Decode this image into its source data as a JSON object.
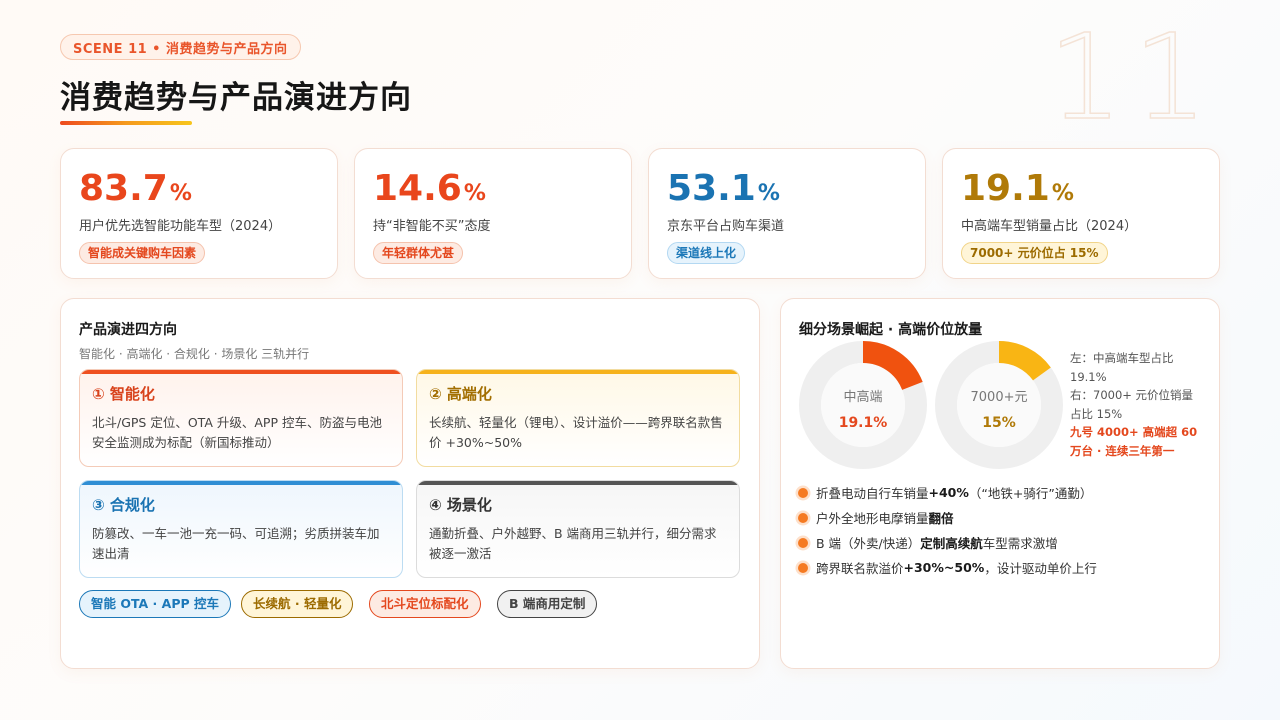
{
  "header": {
    "scene_tag": "SCENE 11 • 消费趋势与产品方向",
    "title": "消费趋势与产品演进方向",
    "watermark_number": "11"
  },
  "stats": [
    {
      "value": "83.7",
      "unit": "%",
      "label": "用户优先选智能功能车型（2024）",
      "badge": "智能成关键购车因素",
      "color": "#e9461c"
    },
    {
      "value": "14.6",
      "unit": "%",
      "label": "持“非智能不买”态度",
      "badge": "年轻群体尤甚",
      "color": "#e9461c"
    },
    {
      "value": "53.1",
      "unit": "%",
      "label": "京东平台占购车渠道",
      "badge": "渠道线上化",
      "color": "#1a73b2"
    },
    {
      "value": "19.1",
      "unit": "%",
      "label": "中高端车型销量占比（2024）",
      "badge": "7000+ 元价位占 15%",
      "color": "#b07a08"
    }
  ],
  "directions": {
    "title": "产品演进四方向",
    "subtitle": "智能化 · 高端化 · 合规化 · 场景化 三轨并行",
    "items": [
      {
        "title": "① 智能化",
        "text": "北斗/GPS 定位、OTA 升级、APP 控车、防盗与电池安全监测成为标配（新国标推动）"
      },
      {
        "title": "② 高端化",
        "text": "长续航、轻量化（锂电）、设计溢价——跨界联名款售价 +30%~50%"
      },
      {
        "title": "③ 合规化",
        "text": "防篡改、一车一池一充一码、可追溯；劣质拼装车加速出清"
      },
      {
        "title": "④ 场景化",
        "text": "通勤折叠、户外越野、B 端商用三轨并行，细分需求被逐一激活"
      }
    ],
    "pills": [
      "智能 OTA · APP 控车",
      "长续航 · 轻量化",
      "北斗定位标配化",
      "B 端商用定制"
    ]
  },
  "segments": {
    "title": "细分场景崛起 · 高端价位放量",
    "donuts": [
      {
        "label": "中高端",
        "value_text": "19.1%",
        "fraction": 0.191,
        "color": "#f0520f"
      },
      {
        "label": "7000+元",
        "value_text": "15%",
        "fraction": 0.15,
        "color": "#f9b514"
      }
    ],
    "notes": [
      "左：中高端车型占比 19.1%",
      "右：7000+ 元价位销量占比 15%"
    ],
    "highlight": "九号 4000+ 高端超 60 万台 · 连续三年第一",
    "bullets": [
      {
        "pre": "折叠电动自行车销量 ",
        "bold": "+40%",
        "post": "（“地铁+骑行”通勤）"
      },
      {
        "pre": "户外全地形电摩销量 ",
        "bold": "翻倍",
        "post": ""
      },
      {
        "pre": "B 端（外卖/快递）",
        "bold": "定制高续航",
        "post": "车型需求激增"
      },
      {
        "pre": "跨界联名款溢价 ",
        "bold": "+30%~50%",
        "post": "，设计驱动单价上行"
      }
    ]
  }
}
